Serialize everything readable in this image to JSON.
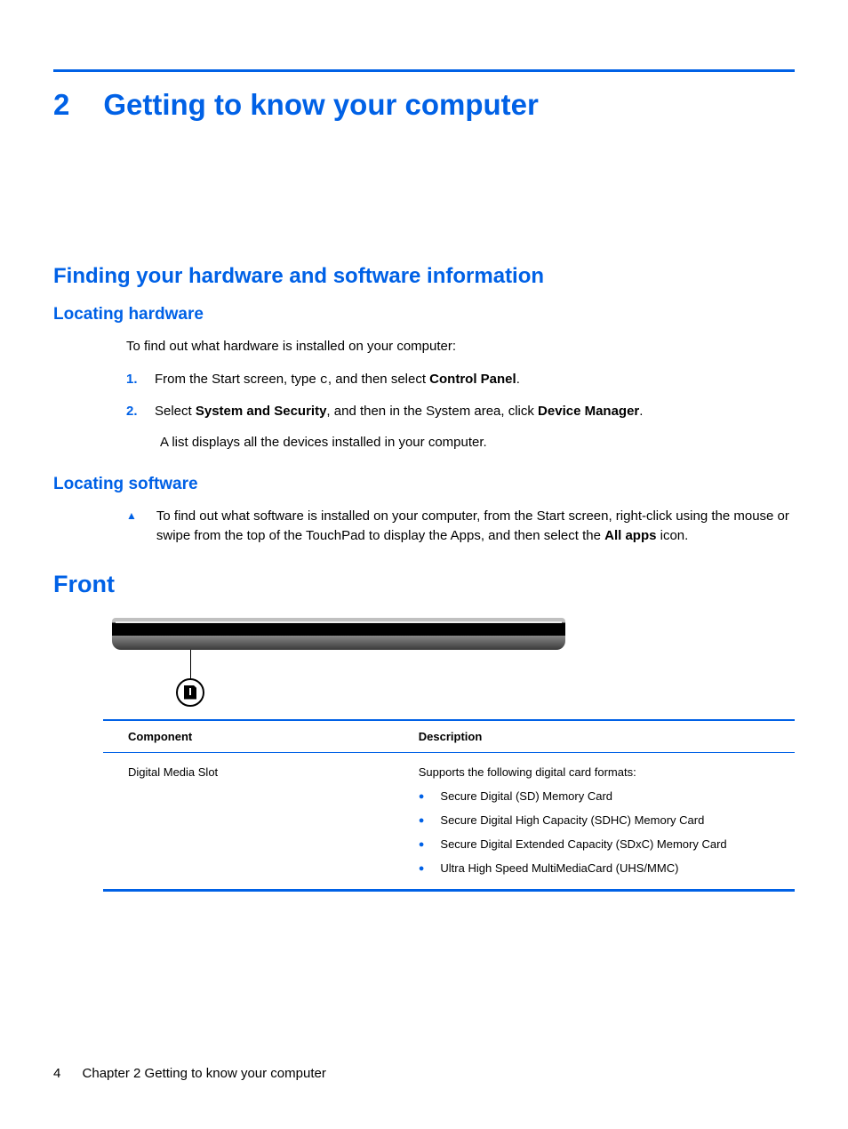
{
  "chapter": {
    "number": "2",
    "title": "Getting to know your computer"
  },
  "section1": {
    "title": "Finding your hardware and software information",
    "sub1": {
      "title": "Locating hardware",
      "intro": "To find out what hardware is installed on your computer:",
      "steps": [
        {
          "num": "1.",
          "pre": "From the Start screen, type ",
          "code": "c",
          "mid": ", and then select ",
          "bold": "Control Panel",
          "post": "."
        },
        {
          "num": "2.",
          "pre": "Select ",
          "bold1": "System and Security",
          "mid": ", and then in the System area, click ",
          "bold2": "Device Manager",
          "post": "."
        }
      ],
      "after": "A list displays all the devices installed in your computer."
    },
    "sub2": {
      "title": "Locating software",
      "bullet_pre": "To find out what software is installed on your computer, from the Start screen, right-click using the mouse or swipe from the top of the TouchPad to display the Apps, and then select the ",
      "bullet_bold": "All apps",
      "bullet_post": " icon."
    }
  },
  "front": {
    "title": "Front",
    "table": {
      "headers": [
        "Component",
        "Description"
      ],
      "component": "Digital Media Slot",
      "desc_intro": "Supports the following digital card formats:",
      "features": [
        "Secure Digital (SD) Memory Card",
        "Secure Digital High Capacity (SDHC) Memory Card",
        "Secure Digital Extended Capacity (SDxC) Memory Card",
        "Ultra High Speed MultiMediaCard (UHS/MMC)"
      ]
    }
  },
  "footer": {
    "page": "4",
    "label": "Chapter 2   Getting to know your computer"
  }
}
